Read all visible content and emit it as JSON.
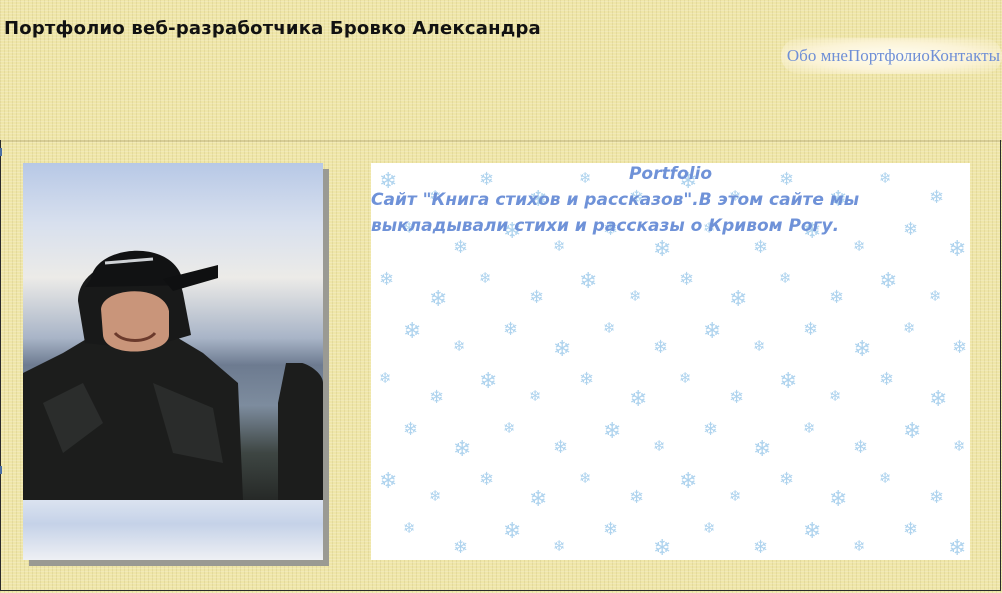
{
  "header": {
    "title": "Портфолио веб-разработчика Бровко Александра"
  },
  "nav": {
    "items": [
      {
        "label": "Обо мне"
      },
      {
        "label": "Портфолио"
      },
      {
        "label": "Контакты"
      }
    ]
  },
  "portfolio": {
    "heading": "Portfolio",
    "description": "Сайт \"Книга стихов и рассказов\".В этом сайте мы выкладывали стихи и рассказы о Кривом Рогу."
  },
  "colors": {
    "page_background": "#efe6a8",
    "link": "#6f8fd6",
    "portfolio_text": "#6f92d8",
    "snowflake": "#aed3ee",
    "panel_background": "#ffffff"
  },
  "icons": {
    "snowflake": "snowflake-icon"
  }
}
